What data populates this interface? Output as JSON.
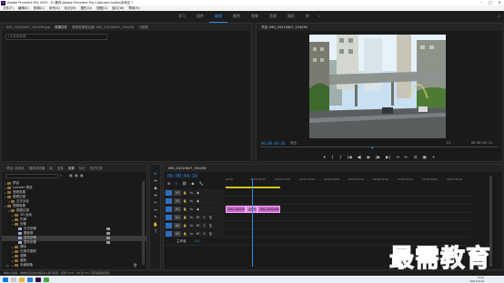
{
  "app": {
    "title": "Adobe Premiere Pro 2020 - E:\\素材\\Adobe Premiere Pro Captured Audio\\未命名 *",
    "icon_label": "Pr"
  },
  "menu": [
    "文件(F)",
    "编辑(E)",
    "剪辑(C)",
    "序列(S)",
    "标记(M)",
    "图形(G)",
    "视图(V)",
    "窗口(W)",
    "帮助(H)"
  ],
  "workspaces": {
    "tabs": [
      "学习",
      "组件",
      "编辑",
      "颜色",
      "效果",
      "音频",
      "图形",
      "库"
    ],
    "active_index": 2,
    "more": "»"
  },
  "source_panel": {
    "tabs": [
      "IMG_20210607_154436.jpg",
      "效果控件",
      "音频剪辑混合器: IMG_20210607_154436",
      "元数据"
    ],
    "active_index": 1,
    "field_placeholder": "(未选择剪辑)"
  },
  "program_panel": {
    "tab": "节目: IMG_20210607_154436",
    "current_time": "00:00:04:16",
    "zoom": "适合",
    "quality": "1/2",
    "duration": "00:00:09:24",
    "controls": [
      "▾",
      "{",
      "}",
      "|◀",
      "◀|",
      "▶",
      "|▶",
      "▶|",
      "⇥",
      "⇤",
      "⊡",
      "▣",
      "+"
    ]
  },
  "project_panel": {
    "tabs": [
      "项目: 未命名",
      "媒体浏览器",
      "库",
      "信息",
      "效果",
      "标记",
      "历史记录"
    ],
    "active_index": 4,
    "search_placeholder": "",
    "items": [
      {
        "label": "预设",
        "level": 0,
        "open": false
      },
      {
        "label": "Lumetri 预设",
        "level": 0,
        "open": false
      },
      {
        "label": "音频效果",
        "level": 0,
        "open": false
      },
      {
        "label": "音频过渡",
        "level": 0,
        "open": true
      },
      {
        "label": "交叉淡化",
        "level": 1,
        "open": true
      },
      {
        "label": "视频效果",
        "level": 0,
        "open": true
      },
      {
        "label": "视频过渡",
        "level": 1,
        "open": true
      },
      {
        "label": "3D 运动",
        "level": 2,
        "open": false
      },
      {
        "label": "内滑",
        "level": 2,
        "open": false
      },
      {
        "label": "划像",
        "level": 2,
        "open": true
      },
      {
        "label": "交叉划像",
        "level": 3,
        "open": false
      },
      {
        "label": "圆划像",
        "level": 3,
        "open": false
      },
      {
        "label": "盒形划像",
        "level": 3,
        "open": false
      },
      {
        "label": "菱形划像",
        "level": 3,
        "open": false
      },
      {
        "label": "擦除",
        "level": 2,
        "open": false
      },
      {
        "label": "沉浸式视频",
        "level": 2,
        "open": false
      },
      {
        "label": "溶解",
        "level": 2,
        "open": false
      },
      {
        "label": "缩放",
        "level": 2,
        "open": false
      },
      {
        "label": "页面剥落",
        "level": 2,
        "open": false
      }
    ],
    "selected_index": 12
  },
  "tools": [
    "▸",
    "⇹",
    "◆",
    "⇼",
    "✂",
    "↔",
    "✎",
    "✋",
    "T"
  ],
  "active_tool_index": 0,
  "timeline": {
    "tab": "IMG_20210607_154436",
    "current_time": "00:00:04:16",
    "ruler_labels": [
      "00:00",
      "00:00:05:00",
      "00:00:10:00",
      "00:00:15:00",
      "00:00:20:00",
      "00:00:25:00",
      "00:00:30:00",
      "00:00:35:00",
      "00:00:40:00",
      "00:00:45:00"
    ],
    "tracks": [
      {
        "name": "V3"
      },
      {
        "name": "V2"
      },
      {
        "name": "V1"
      },
      {
        "name": "A1"
      },
      {
        "name": "A2"
      },
      {
        "name": "A3"
      }
    ],
    "master_label": "主声道",
    "master_value": "0.0",
    "clips": [
      {
        "label": "IMG_20210607_154436.jpg"
      },
      {
        "label": "盒形划像"
      },
      {
        "label": "IMG_20210607_154443.jpg"
      }
    ]
  },
  "status_bar": "单击以选择，或单击空白处并拖动以进行框选。使用 Shift、Alt 和 Ctrl 可获得其他选项。",
  "taskbar": {
    "time": "9:41",
    "date": "2021/7/12"
  },
  "watermark": "最需教育",
  "colors": {
    "accent": "#2d8ceb",
    "clip": "#c768c9",
    "workarea": "#d4c21e",
    "watermark": "#3d5fd7"
  }
}
